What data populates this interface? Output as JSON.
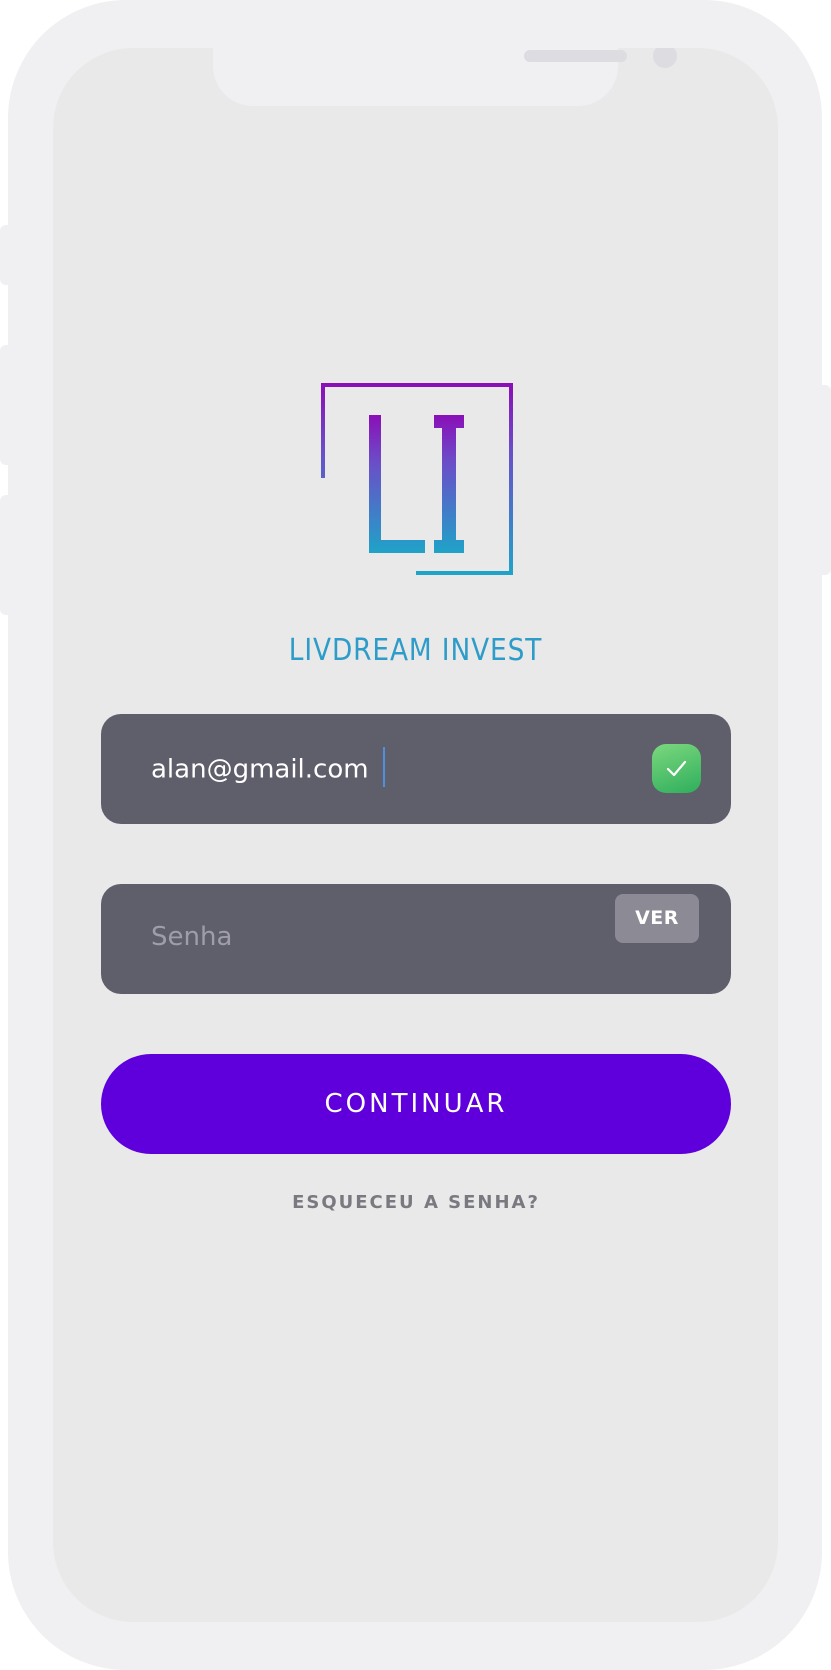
{
  "brand": {
    "monogram": "LI",
    "name": "LIVDREAM INVEST"
  },
  "login": {
    "email": {
      "value": "alan@gmail.com",
      "valid": true
    },
    "password": {
      "placeholder": "Senha",
      "value": "",
      "reveal_label": "VER"
    },
    "continue_label": "CONTINUAR",
    "forgot_label": "ESQUECEU A SENHA?"
  },
  "colors": {
    "primary": "#5f00dc",
    "field_bg": "#5f5e6b",
    "logo_gradient_start": "#8a0fb8",
    "logo_gradient_end": "#1fa3c8",
    "success": "#2fae5c"
  }
}
